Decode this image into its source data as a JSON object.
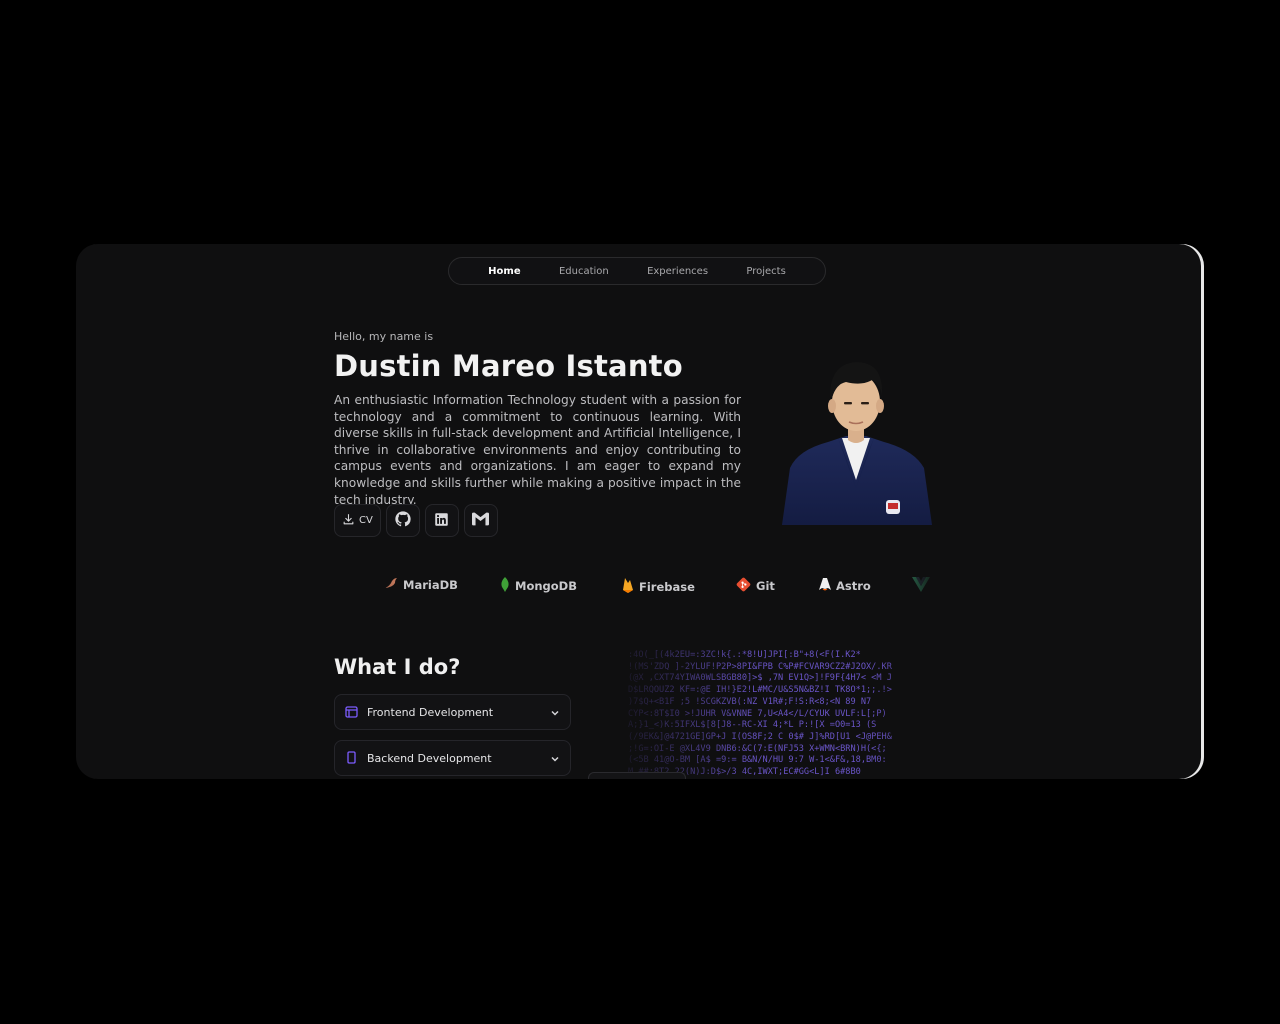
{
  "nav": {
    "items": [
      {
        "label": "Home",
        "active": true
      },
      {
        "label": "Education",
        "active": false
      },
      {
        "label": "Experiences",
        "active": false
      },
      {
        "label": "Projects",
        "active": false
      }
    ]
  },
  "hero": {
    "greeting": "Hello, my name is",
    "name": "Dustin Mareo Istanto",
    "bio": "An enthusiastic Information Technology student with a passion for technology and a commitment to continuous learning. With diverse skills in full-stack development and Artificial Intelligence, I thrive in collaborative environments and enjoy contributing to campus events and organizations. I am eager to expand my knowledge and skills further while making a positive impact in the tech industry.",
    "cv_label": "CV"
  },
  "socials": [
    {
      "icon": "download-icon",
      "label": "CV"
    },
    {
      "icon": "github-icon"
    },
    {
      "icon": "linkedin-icon"
    },
    {
      "icon": "gmail-icon"
    }
  ],
  "tech": [
    {
      "label": "MariaDB",
      "icon": "mariadb-icon",
      "color": "#c0765a"
    },
    {
      "label": "MongoDB",
      "icon": "mongodb-icon",
      "color": "#3fa037"
    },
    {
      "label": "Firebase",
      "icon": "firebase-icon",
      "color": "#f5a623"
    },
    {
      "label": "Git",
      "icon": "git-icon",
      "color": "#e84e31"
    },
    {
      "label": "Astro",
      "icon": "astro-icon",
      "color": "#ffffff"
    },
    {
      "label": "",
      "icon": "vue-icon",
      "color": "#41b883"
    }
  ],
  "what_i_do": {
    "title": "What I do?",
    "items": [
      {
        "label": "Frontend Development",
        "icon": "browser-window-icon"
      },
      {
        "label": "Backend Development",
        "icon": "server-icon"
      }
    ]
  },
  "colors": {
    "accent": "#7c5cff",
    "background": "#0f0f10"
  },
  "matrix_text": ":4O(_[(4k2EU=:3ZC!k{.:*8!U]JPI[:B\"+8(<F(I.K2*\n!(MS'ZDQ ]-2YLUF!P2P>8PI&FPB C%P#FCVAR9CZ2#J2OX/.KR\n(@X ,CXT74YIWA0WLSBGB80]>$ ,7N EV1Q>]!F9F{4H7< <M J\nD$LRQOUZ2 KF=:@E IH!}E2!L#MC/U&S5N&BZ!I TK8O*1;;.!>\n)7$Q+<B1F ;5 !SCGKZVB(:NZ V1R#;F!S:R<8;<N 89 N7\nCYP<:8T$I0 >!JUHR V&VNNE 7,U<A4</L/CYUK UVLF:L[;P)\nA;}1_<)K:5IFXL$[8[J8--RC-XI 4;*L P:![X =O0=13 (S\n(/9EK&]@4721GE]GP+J I(OS8F;2 C 0$# J]%RD[U1 <J@PEH&\n;!G=:OI-E @XL4V9 DNB6:&C(7:E(NFJ53 X+WMN<BRN)H(<{;\n(<5B 41@O-BM [A$ =9:= B&N/N/HU 9:7 W-1<&F&,18,BM0:\nM ##;8T2 22(N)J:D$>/3 4C,IWXT;EC#GG<L]I 6#8B0"
}
